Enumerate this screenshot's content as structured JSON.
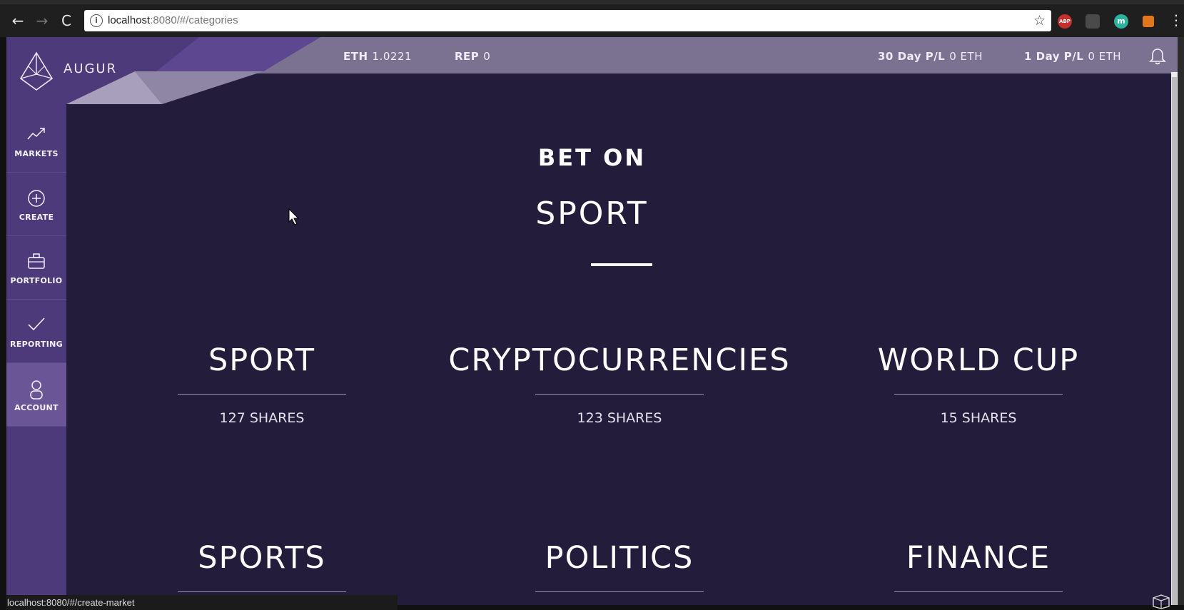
{
  "browser": {
    "url_host": "localhost",
    "url_rest": ":8080/#/categories",
    "status_url": "localhost:8080/#/create-market",
    "extensions": {
      "abp": "ABP",
      "m": "m"
    }
  },
  "app": {
    "logo_text": "AUGUR",
    "stats": {
      "eth_label": "ETH",
      "eth_value": "1.0221",
      "rep_label": "REP",
      "rep_value": "0",
      "pl30_label": "30 Day P/L",
      "pl30_value": "0 ETH",
      "pl1_label": "1 Day P/L",
      "pl1_value": "0 ETH"
    },
    "sidebar": [
      {
        "label": "MARKETS",
        "icon": "trending-up-icon"
      },
      {
        "label": "CREATE",
        "icon": "plus-circle-icon"
      },
      {
        "label": "PORTFOLIO",
        "icon": "briefcase-icon"
      },
      {
        "label": "REPORTING",
        "icon": "checkmark-icon"
      },
      {
        "label": "ACCOUNT",
        "icon": "user-icon"
      }
    ],
    "hero": {
      "bet_on": "BET ON",
      "topic": "SPORT"
    },
    "categories": [
      {
        "name": "SPORT",
        "shares": "127 SHARES"
      },
      {
        "name": "CRYPTOCURRENCIES",
        "shares": "123 SHARES"
      },
      {
        "name": "WORLD CUP",
        "shares": "15 SHARES"
      },
      {
        "name": "SPORTS",
        "shares": ""
      },
      {
        "name": "POLITICS",
        "shares": ""
      },
      {
        "name": "FINANCE",
        "shares": ""
      }
    ]
  },
  "colors": {
    "background": "#241c3b",
    "topbar": "#7b7191",
    "sidebar": "#4d3a7b",
    "sidebar_active": "#6a5696"
  }
}
